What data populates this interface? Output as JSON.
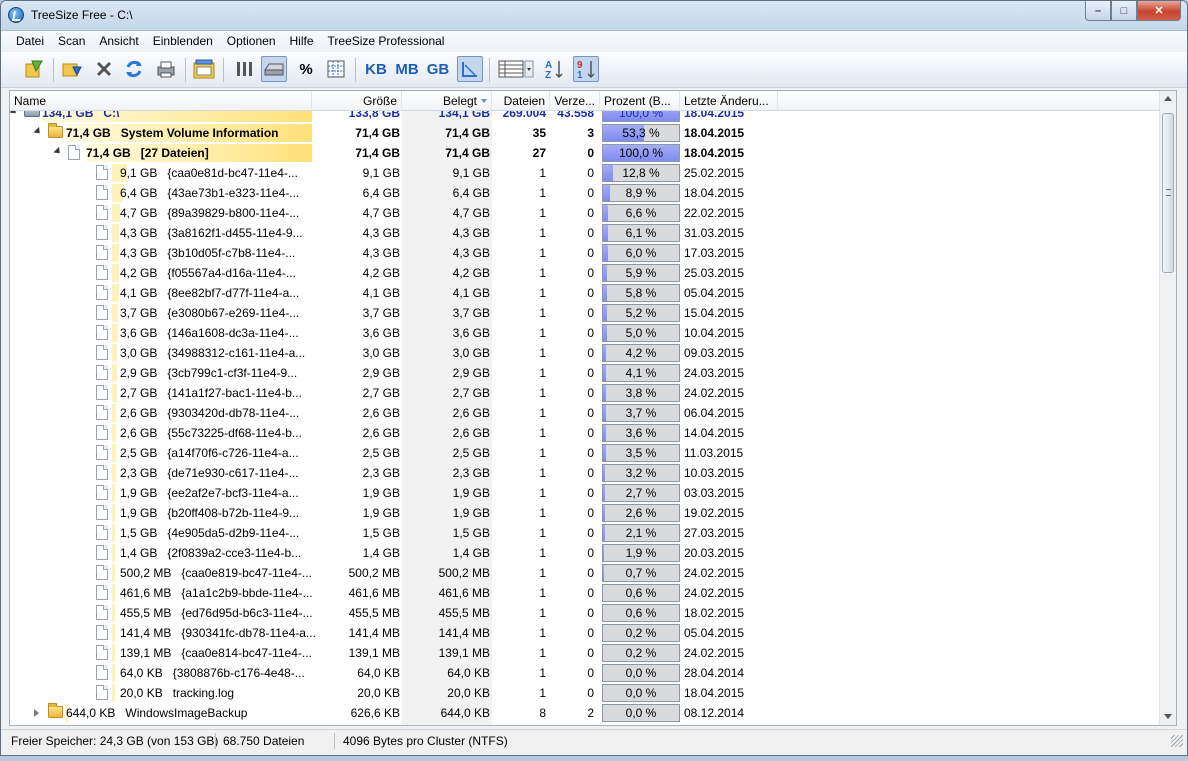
{
  "window": {
    "title": "TreeSize Free - C:\\",
    "minimize_label": "–",
    "maximize_label": "□",
    "close_label": "✕"
  },
  "menu": [
    "Datei",
    "Scan",
    "Ansicht",
    "Einblenden",
    "Optionen",
    "Hilfe",
    "TreeSize Professional"
  ],
  "toolbar": {
    "icons": [
      "select-directory-icon",
      "scan-icon",
      "stop-icon",
      "refresh-icon",
      "print-icon",
      "export-icon",
      "columns-icon",
      "drive-view-icon",
      "percent-icon",
      "grid-icon",
      "kb-unit-icon",
      "mb-unit-icon",
      "gb-unit-icon",
      "chart-icon",
      "details-view-icon",
      "sort-az-icon",
      "sort-91-icon"
    ],
    "percent_label": "%",
    "kb_label": "KB",
    "mb_label": "MB",
    "gb_label": "GB",
    "az_label": "AZ",
    "nine_one_label": "91"
  },
  "columns": {
    "name": "Name",
    "size": "Größe",
    "allocated": "Belegt",
    "files": "Dateien",
    "dirs": "Verze...",
    "percent": "Prozent (B...",
    "modified": "Letzte Änderu..."
  },
  "rows": [
    {
      "label": "134,1 GB   C:\\",
      "size": "133,8 GB",
      "allocated": "134,1 GB",
      "files": "269.004",
      "dirs": "43.558",
      "percent": "100,0 %",
      "pct": 100,
      "date": "18.04.2015",
      "type": "drive",
      "level": 0,
      "bold": true,
      "bar": 1.0,
      "expand": "open"
    },
    {
      "label": "71,4 GB   System Volume Information",
      "size": "71,4 GB",
      "allocated": "71,4 GB",
      "files": "35",
      "dirs": "3",
      "percent": "53,3 %",
      "pct": 53.3,
      "date": "18.04.2015",
      "type": "folder",
      "level": 1,
      "bold": true,
      "bar": 1.0,
      "expand": "open"
    },
    {
      "label": "71,4 GB   [27 Dateien]",
      "size": "71,4 GB",
      "allocated": "71,4 GB",
      "files": "27",
      "dirs": "0",
      "percent": "100,0 %",
      "pct": 100,
      "date": "18.04.2015",
      "type": "file",
      "level": 2,
      "bold": true,
      "bar": 1.0,
      "expand": "open"
    },
    {
      "label": "9,1 GB   {caa0e81d-bc47-11e4-...",
      "size": "9,1 GB",
      "allocated": "9,1 GB",
      "files": "1",
      "dirs": "0",
      "percent": "12,8 %",
      "pct": 12.8,
      "date": "25.02.2015",
      "type": "file",
      "level": 3,
      "bold": false,
      "bar": 0.128
    },
    {
      "label": "6,4 GB   {43ae73b1-e323-11e4-...",
      "size": "6,4 GB",
      "allocated": "6,4 GB",
      "files": "1",
      "dirs": "0",
      "percent": "8,9 %",
      "pct": 8.9,
      "date": "18.04.2015",
      "type": "file",
      "level": 3,
      "bold": false,
      "bar": 0.089
    },
    {
      "label": "4,7 GB   {89a39829-b800-11e4-...",
      "size": "4,7 GB",
      "allocated": "4,7 GB",
      "files": "1",
      "dirs": "0",
      "percent": "6,6 %",
      "pct": 6.6,
      "date": "22.02.2015",
      "type": "file",
      "level": 3,
      "bold": false,
      "bar": 0.066
    },
    {
      "label": "4,3 GB   {3a8162f1-d455-11e4-9...",
      "size": "4,3 GB",
      "allocated": "4,3 GB",
      "files": "1",
      "dirs": "0",
      "percent": "6,1 %",
      "pct": 6.1,
      "date": "31.03.2015",
      "type": "file",
      "level": 3,
      "bold": false,
      "bar": 0.061
    },
    {
      "label": "4,3 GB   {3b10d05f-c7b8-11e4-...",
      "size": "4,3 GB",
      "allocated": "4,3 GB",
      "files": "1",
      "dirs": "0",
      "percent": "6,0 %",
      "pct": 6.0,
      "date": "17.03.2015",
      "type": "file",
      "level": 3,
      "bold": false,
      "bar": 0.06
    },
    {
      "label": "4,2 GB   {f05567a4-d16a-11e4-...",
      "size": "4,2 GB",
      "allocated": "4,2 GB",
      "files": "1",
      "dirs": "0",
      "percent": "5,9 %",
      "pct": 5.9,
      "date": "25.03.2015",
      "type": "file",
      "level": 3,
      "bold": false,
      "bar": 0.059
    },
    {
      "label": "4,1 GB   {8ee82bf7-d77f-11e4-a...",
      "size": "4,1 GB",
      "allocated": "4,1 GB",
      "files": "1",
      "dirs": "0",
      "percent": "5,8 %",
      "pct": 5.8,
      "date": "05.04.2015",
      "type": "file",
      "level": 3,
      "bold": false,
      "bar": 0.058
    },
    {
      "label": "3,7 GB   {e3080b67-e269-11e4-...",
      "size": "3,7 GB",
      "allocated": "3,7 GB",
      "files": "1",
      "dirs": "0",
      "percent": "5,2 %",
      "pct": 5.2,
      "date": "15.04.2015",
      "type": "file",
      "level": 3,
      "bold": false,
      "bar": 0.052
    },
    {
      "label": "3,6 GB   {146a1608-dc3a-11e4-...",
      "size": "3,6 GB",
      "allocated": "3,6 GB",
      "files": "1",
      "dirs": "0",
      "percent": "5,0 %",
      "pct": 5.0,
      "date": "10.04.2015",
      "type": "file",
      "level": 3,
      "bold": false,
      "bar": 0.05
    },
    {
      "label": "3,0 GB   {34988312-c161-11e4-a...",
      "size": "3,0 GB",
      "allocated": "3,0 GB",
      "files": "1",
      "dirs": "0",
      "percent": "4,2 %",
      "pct": 4.2,
      "date": "09.03.2015",
      "type": "file",
      "level": 3,
      "bold": false,
      "bar": 0.042
    },
    {
      "label": "2,9 GB   {3cb799c1-cf3f-11e4-9...",
      "size": "2,9 GB",
      "allocated": "2,9 GB",
      "files": "1",
      "dirs": "0",
      "percent": "4,1 %",
      "pct": 4.1,
      "date": "24.03.2015",
      "type": "file",
      "level": 3,
      "bold": false,
      "bar": 0.041
    },
    {
      "label": "2,7 GB   {141a1f27-bac1-11e4-b...",
      "size": "2,7 GB",
      "allocated": "2,7 GB",
      "files": "1",
      "dirs": "0",
      "percent": "3,8 %",
      "pct": 3.8,
      "date": "24.02.2015",
      "type": "file",
      "level": 3,
      "bold": false,
      "bar": 0.038
    },
    {
      "label": "2,6 GB   {9303420d-db78-11e4-...",
      "size": "2,6 GB",
      "allocated": "2,6 GB",
      "files": "1",
      "dirs": "0",
      "percent": "3,7 %",
      "pct": 3.7,
      "date": "06.04.2015",
      "type": "file",
      "level": 3,
      "bold": false,
      "bar": 0.037
    },
    {
      "label": "2,6 GB   {55c73225-df68-11e4-b...",
      "size": "2,6 GB",
      "allocated": "2,6 GB",
      "files": "1",
      "dirs": "0",
      "percent": "3,6 %",
      "pct": 3.6,
      "date": "14.04.2015",
      "type": "file",
      "level": 3,
      "bold": false,
      "bar": 0.036
    },
    {
      "label": "2,5 GB   {a14f70f6-c726-11e4-a...",
      "size": "2,5 GB",
      "allocated": "2,5 GB",
      "files": "1",
      "dirs": "0",
      "percent": "3,5 %",
      "pct": 3.5,
      "date": "11.03.2015",
      "type": "file",
      "level": 3,
      "bold": false,
      "bar": 0.035
    },
    {
      "label": "2,3 GB   {de71e930-c617-11e4-...",
      "size": "2,3 GB",
      "allocated": "2,3 GB",
      "files": "1",
      "dirs": "0",
      "percent": "3,2 %",
      "pct": 3.2,
      "date": "10.03.2015",
      "type": "file",
      "level": 3,
      "bold": false,
      "bar": 0.032
    },
    {
      "label": "1,9 GB   {ee2af2e7-bcf3-11e4-a...",
      "size": "1,9 GB",
      "allocated": "1,9 GB",
      "files": "1",
      "dirs": "0",
      "percent": "2,7 %",
      "pct": 2.7,
      "date": "03.03.2015",
      "type": "file",
      "level": 3,
      "bold": false,
      "bar": 0.027
    },
    {
      "label": "1,9 GB   {b20ff408-b72b-11e4-9...",
      "size": "1,9 GB",
      "allocated": "1,9 GB",
      "files": "1",
      "dirs": "0",
      "percent": "2,6 %",
      "pct": 2.6,
      "date": "19.02.2015",
      "type": "file",
      "level": 3,
      "bold": false,
      "bar": 0.026
    },
    {
      "label": "1,5 GB   {4e905da5-d2b9-11e4-...",
      "size": "1,5 GB",
      "allocated": "1,5 GB",
      "files": "1",
      "dirs": "0",
      "percent": "2,1 %",
      "pct": 2.1,
      "date": "27.03.2015",
      "type": "file",
      "level": 3,
      "bold": false,
      "bar": 0.021
    },
    {
      "label": "1,4 GB   {2f0839a2-cce3-11e4-b...",
      "size": "1,4 GB",
      "allocated": "1,4 GB",
      "files": "1",
      "dirs": "0",
      "percent": "1,9 %",
      "pct": 1.9,
      "date": "20.03.2015",
      "type": "file",
      "level": 3,
      "bold": false,
      "bar": 0.019
    },
    {
      "label": "500,2 MB   {caa0e819-bc47-11e4-...",
      "size": "500,2 MB",
      "allocated": "500,2 MB",
      "files": "1",
      "dirs": "0",
      "percent": "0,7 %",
      "pct": 0.7,
      "date": "24.02.2015",
      "type": "file",
      "level": 3,
      "bold": false,
      "bar": 0.007
    },
    {
      "label": "461,6 MB   {a1a1c2b9-bbde-11e4-...",
      "size": "461,6 MB",
      "allocated": "461,6 MB",
      "files": "1",
      "dirs": "0",
      "percent": "0,6 %",
      "pct": 0.6,
      "date": "24.02.2015",
      "type": "file",
      "level": 3,
      "bold": false,
      "bar": 0.006
    },
    {
      "label": "455,5 MB   {ed76d95d-b6c3-11e4-...",
      "size": "455,5 MB",
      "allocated": "455,5 MB",
      "files": "1",
      "dirs": "0",
      "percent": "0,6 %",
      "pct": 0.6,
      "date": "18.02.2015",
      "type": "file",
      "level": 3,
      "bold": false,
      "bar": 0.006
    },
    {
      "label": "141,4 MB   {930341fc-db78-11e4-a...",
      "size": "141,4 MB",
      "allocated": "141,4 MB",
      "files": "1",
      "dirs": "0",
      "percent": "0,2 %",
      "pct": 0.2,
      "date": "05.04.2015",
      "type": "file",
      "level": 3,
      "bold": false,
      "bar": 0.002
    },
    {
      "label": "139,1 MB   {caa0e814-bc47-11e4-...",
      "size": "139,1 MB",
      "allocated": "139,1 MB",
      "files": "1",
      "dirs": "0",
      "percent": "0,2 %",
      "pct": 0.2,
      "date": "24.02.2015",
      "type": "file",
      "level": 3,
      "bold": false,
      "bar": 0.002
    },
    {
      "label": "64,0 KB   {3808876b-c176-4e48-...",
      "size": "64,0 KB",
      "allocated": "64,0 KB",
      "files": "1",
      "dirs": "0",
      "percent": "0,0 %",
      "pct": 0.0,
      "date": "28.04.2014",
      "type": "file",
      "level": 3,
      "bold": false,
      "bar": 0.0
    },
    {
      "label": "20,0 KB   tracking.log",
      "size": "20,0 KB",
      "allocated": "20,0 KB",
      "files": "1",
      "dirs": "0",
      "percent": "0,0 %",
      "pct": 0.0,
      "date": "18.04.2015",
      "type": "file",
      "level": 3,
      "bold": false,
      "bar": 0.0
    },
    {
      "label": "644,0 KB   WindowsImageBackup",
      "size": "626,6 KB",
      "allocated": "644,0 KB",
      "files": "8",
      "dirs": "2",
      "percent": "0,0 %",
      "pct": 0.0,
      "date": "08.12.2014",
      "type": "folder",
      "level": 1,
      "bold": false,
      "bar": 0.0,
      "expand": "closed"
    }
  ],
  "status": {
    "free": "Freier Speicher: 24,3 GB  (von 153 GB)",
    "files": "68.750  Dateien",
    "cluster": "4096 Bytes pro Cluster (NTFS)"
  }
}
